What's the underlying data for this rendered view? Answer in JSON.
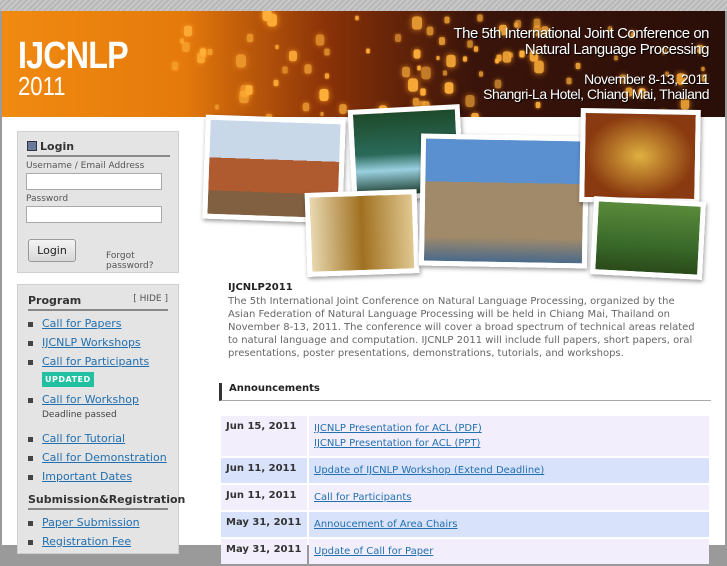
{
  "header": {
    "logo_main": "IJCNLP",
    "logo_year": "2011",
    "title_line1": "The 5th International Joint Conference on",
    "title_line2": "Natural Language Processing",
    "dates": "November 8-13, 2011",
    "venue": "Shangri-La Hotel, Chiang Mai, Thailand"
  },
  "login": {
    "title": "Login",
    "username_label": "Username / Email Address",
    "password_label": "Password",
    "button": "Login",
    "forgot": "Forgot password?"
  },
  "program": {
    "title": "Program",
    "hide": "[ HIDE ]",
    "items": [
      {
        "label": "Call for Papers"
      },
      {
        "label": "IJCNLP Workshops"
      },
      {
        "label": "Call for Participants",
        "badge": "UPDATED"
      },
      {
        "label": "Call for Workshop",
        "note": "Deadline passed"
      },
      {
        "label": "Call for Tutorial"
      },
      {
        "label": "Call for Demonstration"
      },
      {
        "label": "Important Dates"
      }
    ]
  },
  "submission": {
    "title": "Submission&Registration",
    "items": [
      {
        "label": "Paper Submission"
      },
      {
        "label": "Registration Fee"
      }
    ]
  },
  "intro": {
    "title": "IJCNLP2011",
    "text": "The 5th International Joint Conference on Natural Language Processing, organized by the Asian Federation of Natural Language Processing will be held in Chiang Mai, Thailand on November 8-13, 2011. The conference will cover a broad spectrum of technical areas related to natural language and computation. IJCNLP 2011 will include full papers, short papers, oral presentations, poster presentations, demonstrations, tutorials, and workshops."
  },
  "announcements": {
    "title": "Announcements",
    "rows": [
      {
        "date": "Jun 15, 2011",
        "links": [
          "IJCNLP Presentation for ACL (PDF)",
          "IJCNLP Presentation for ACL (PPT)"
        ]
      },
      {
        "date": "Jun 11, 2011",
        "links": [
          "Update of IJCNLP Workshop (Extend Deadline)"
        ]
      },
      {
        "date": "Jun 11, 2011",
        "links": [
          "Call for Participants"
        ]
      },
      {
        "date": "May 31, 2011",
        "links": [
          "Annoucement of Area Chairs"
        ]
      },
      {
        "date": "May 31, 2011",
        "links": [
          "Update of Call for Paper"
        ]
      }
    ]
  }
}
